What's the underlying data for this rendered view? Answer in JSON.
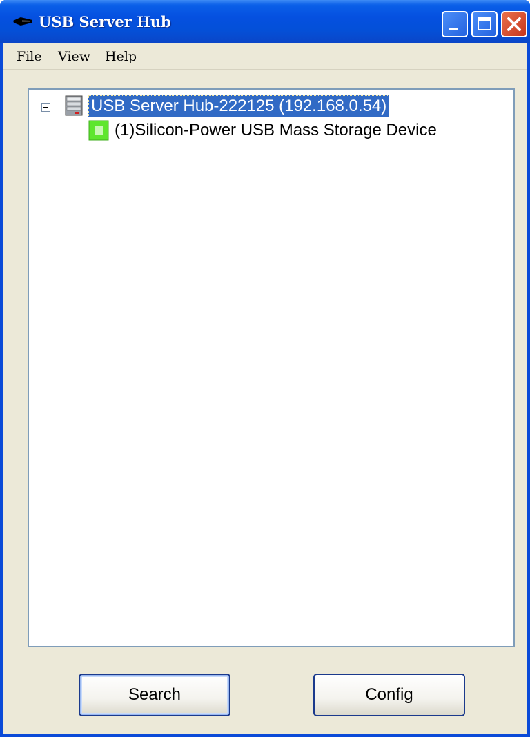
{
  "window": {
    "title": "USB Server Hub",
    "title_color": "#ffffff",
    "frame_color": "#0a4ad8"
  },
  "titlebar_buttons": [
    "minimize-icon",
    "maximize-icon",
    "close-icon"
  ],
  "menu": {
    "items": [
      "File",
      "View",
      "Help"
    ]
  },
  "tree": {
    "root": {
      "label": "USB Server Hub-222125 (192.168.0.54)",
      "icon": "server-icon",
      "expanded": true,
      "selected": true
    },
    "children": [
      {
        "label": "(1)Silicon-Power USB Mass Storage Device",
        "icon": "usb-device-icon",
        "status_color": "#5ee62e"
      }
    ],
    "selection_color": "#316ac5"
  },
  "buttons": {
    "search_label": "Search",
    "config_label": "Config"
  }
}
